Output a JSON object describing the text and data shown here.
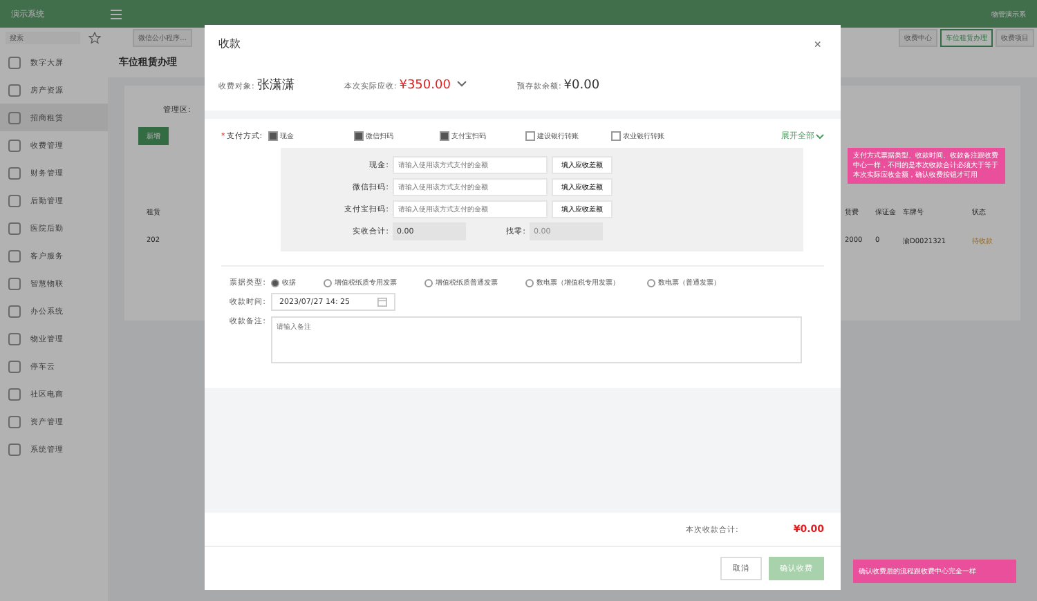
{
  "app": {
    "title": "演示系统",
    "user": "物管演示系"
  },
  "sidebar": {
    "search_placeholder": "搜索",
    "items": [
      {
        "label": "数字大屏",
        "selected": false
      },
      {
        "label": "房产资源",
        "selected": false
      },
      {
        "label": "招商租赁",
        "selected": true
      },
      {
        "label": "收费管理",
        "selected": false
      },
      {
        "label": "财务管理",
        "selected": false
      },
      {
        "label": "后勤管理",
        "selected": false
      },
      {
        "label": "医院后勤",
        "selected": false
      },
      {
        "label": "客户服务",
        "selected": false
      },
      {
        "label": "智慧物联",
        "selected": false
      },
      {
        "label": "办公系统",
        "selected": false
      },
      {
        "label": "物业管理",
        "selected": false
      },
      {
        "label": "停车云",
        "selected": false
      },
      {
        "label": "社区电商",
        "selected": false
      },
      {
        "label": "资产管理",
        "selected": false
      },
      {
        "label": "系统管理",
        "selected": false
      }
    ]
  },
  "tabs": [
    {
      "label": "微信公小程序…",
      "selected": false
    },
    {
      "label": "收费中心",
      "selected": false
    },
    {
      "label": "车位租赁办理",
      "selected": true
    },
    {
      "label": "收费项目",
      "selected": false
    }
  ],
  "page": {
    "title": "车位租赁办理",
    "filter_label": "管理区:",
    "add_button": "新增",
    "columns": [
      "租赁",
      "赁费",
      "保证金",
      "车牌号",
      "状态"
    ],
    "rows": [
      {
        "cells": [
          "202",
          "2000",
          "0",
          "渝D0021321"
        ],
        "status": "待收款"
      }
    ]
  },
  "dialog": {
    "title": "收款",
    "close": "×",
    "required_mark": "*",
    "payer_label": "收费对象:",
    "payer": "张潇潇",
    "due_label": "本次实际应收:",
    "due": "¥350.00",
    "balance_label": "预存款余额:",
    "balance": "¥0.00",
    "pay_label": "支付方式:",
    "methods": [
      {
        "label": "现金",
        "checked": true
      },
      {
        "label": "微信扫码",
        "checked": true
      },
      {
        "label": "支付宝扫码",
        "checked": true
      },
      {
        "label": "建设银行转账",
        "checked": false
      },
      {
        "label": "农业银行转账",
        "checked": false
      }
    ],
    "expand": "展开全部",
    "amounts": [
      {
        "label": "现金:",
        "placeholder": "请输入使用该方式支付的金额",
        "button": "填入应收差额"
      },
      {
        "label": "微信扫码:",
        "placeholder": "请输入使用该方式支付的金额",
        "button": "填入应收差额"
      },
      {
        "label": "支付宝扫码:",
        "placeholder": "请输入使用该方式支付的金额",
        "button": "填入应收差额"
      }
    ],
    "total_label": "实收合计:",
    "total": "0.00",
    "change_label": "找零:",
    "change": "0.00",
    "receipt_label": "票据类型:",
    "receipts": [
      {
        "label": "收据",
        "selected": true
      },
      {
        "label": "增值税纸质专用发票",
        "selected": false
      },
      {
        "label": "增值税纸质普通发票",
        "selected": false
      },
      {
        "label": "数电票（增值税专用发票）",
        "selected": false
      },
      {
        "label": "数电票（普通发票）",
        "selected": false
      }
    ],
    "time_label": "收款时间:",
    "time": "2023/07/27  14: 25",
    "note_label": "收款备注:",
    "note_placeholder": "请输入备注",
    "sum_label": "本次收款合计:",
    "sum": "¥0.00",
    "cancel": "取消",
    "confirm": "确认收费",
    "confirm_disabled": true
  },
  "notes": [
    "支付方式票据类型、收款时间、收款备注跟收费中心一样，不同的是本次收款合计必须大于等于本次实际应收金额，确认收费按钮才可用",
    "确认收费后的流程跟收费中心完全一样"
  ]
}
